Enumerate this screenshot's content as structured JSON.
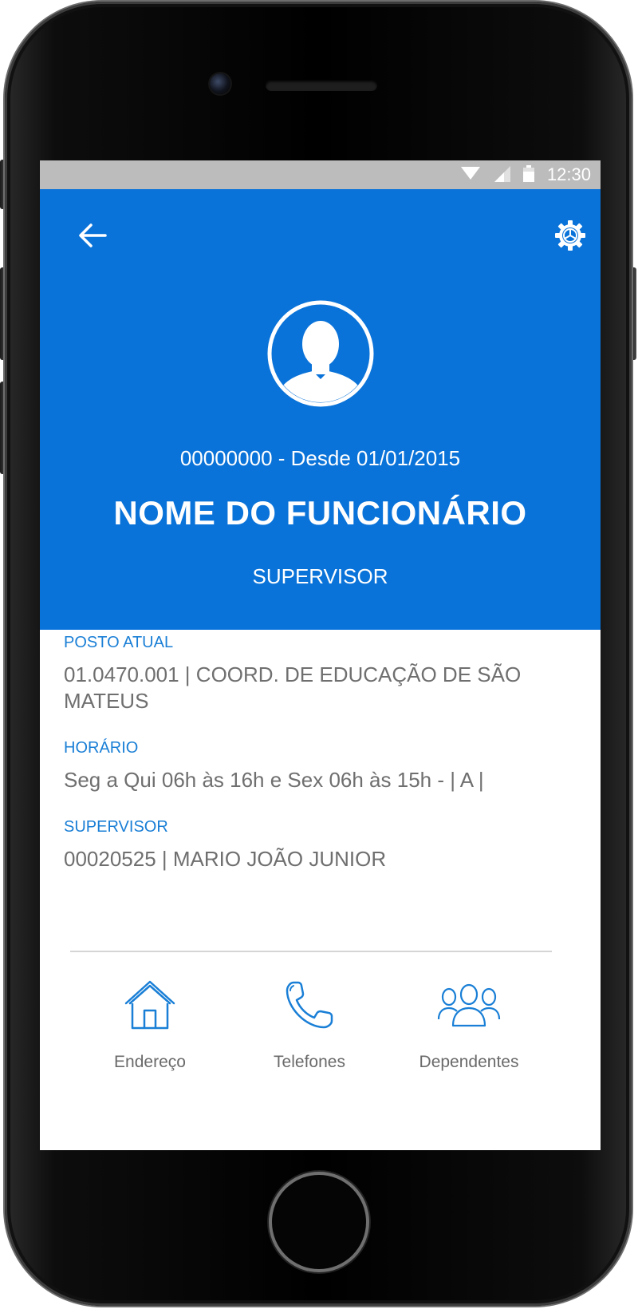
{
  "status_bar": {
    "time": "12:30",
    "icons": [
      "wifi-icon",
      "signal-icon",
      "battery-icon"
    ]
  },
  "header": {
    "back_icon": "arrow-left-icon",
    "settings_icon": "gear-icon",
    "employee_id_line": "00000000 - Desde 01/01/2015",
    "employee_name": "NOME DO FUNCIONÁRIO",
    "employee_role": "SUPERVISOR"
  },
  "details": {
    "posto": {
      "label": "POSTO ATUAL",
      "value": "01.0470.001 | COORD. DE EDUCAÇÃO DE SÃO MATEUS"
    },
    "horario": {
      "label": "HORÁRIO",
      "value": "Seg a Qui 06h às 16h e Sex 06h às 15h - | A |"
    },
    "supervisor": {
      "label": "SUPERVISOR",
      "value": "00020525 | MARIO JOÃO JUNIOR"
    }
  },
  "bottom_nav": [
    {
      "label": "Endereço",
      "icon": "house-icon"
    },
    {
      "label": "Telefones",
      "icon": "phone-icon"
    },
    {
      "label": "Dependentes",
      "icon": "people-icon"
    }
  ],
  "colors": {
    "primary": "#0a73d9",
    "label_blue": "#1a7fd6",
    "status_bar": "#bcbcbc",
    "text_gray": "#6f6f6f"
  }
}
